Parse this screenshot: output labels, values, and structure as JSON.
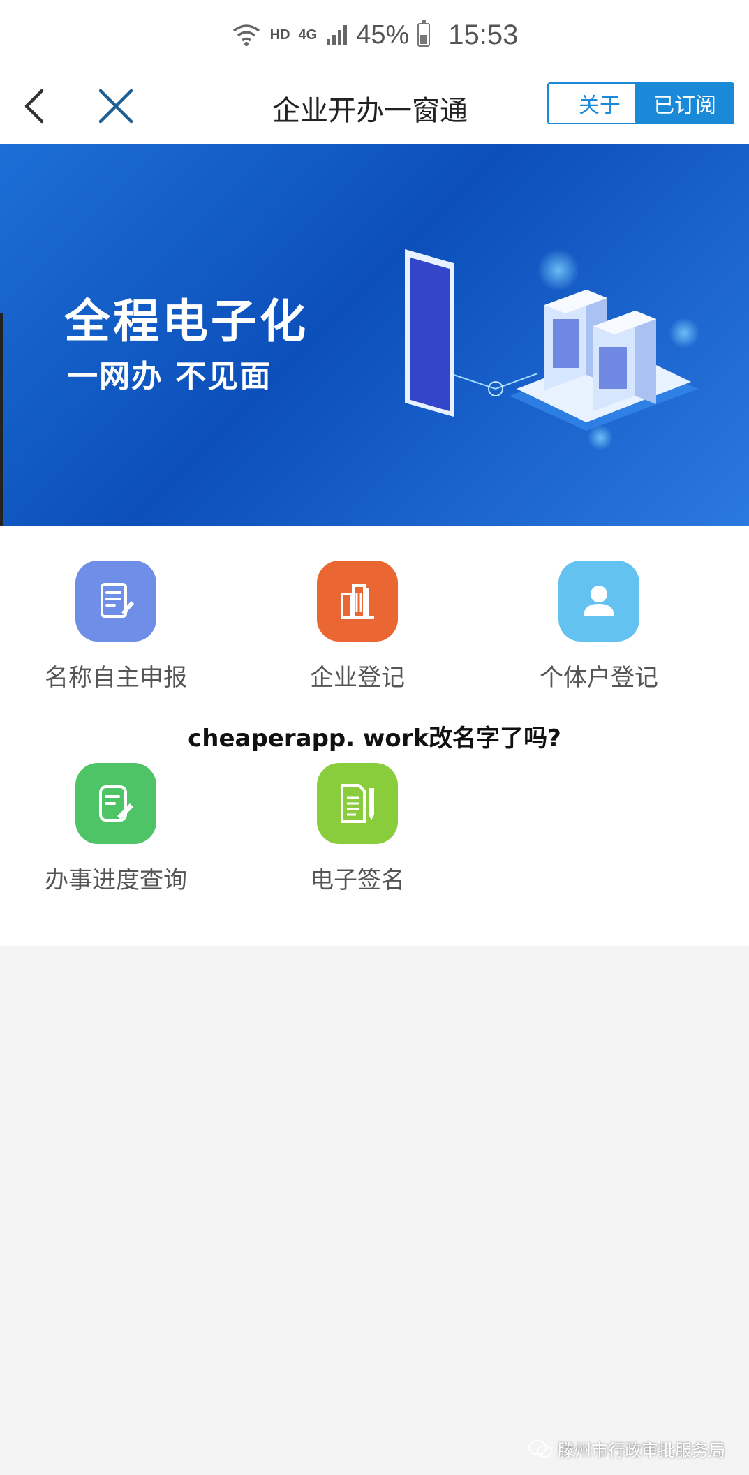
{
  "status_bar": {
    "network_label": "HD",
    "signal_label": "4G",
    "battery_percent": "45%",
    "time": "15:53",
    "icons": [
      "wifi-icon",
      "signal-icon",
      "battery-icon"
    ]
  },
  "title_bar": {
    "title": "企业开办一窗通",
    "about_label": "关于",
    "subscribed_label": "已订阅",
    "icons": [
      "back-icon",
      "close-icon"
    ]
  },
  "banner": {
    "heading": "全程电子化",
    "subheading": "一网办 不见面"
  },
  "services": [
    {
      "label": "名称自主申报",
      "icon": "edit-form-icon",
      "color": "#6f8ee8"
    },
    {
      "label": "企业登记",
      "icon": "building-icon",
      "color": "#ea6632"
    },
    {
      "label": "个体户登记",
      "icon": "person-icon",
      "color": "#64c2f0"
    },
    {
      "label": "办事进度查询",
      "icon": "progress-check-icon",
      "color": "#4fc466"
    },
    {
      "label": "电子签名",
      "icon": "document-sign-icon",
      "color": "#8acd3c"
    }
  ],
  "overlay_caption": "cheaperapp. work改名字了吗?",
  "watermark": "滕州市行政审批服务局",
  "colors": {
    "accent": "#1a8ad8",
    "banner": "#1265cc",
    "background": "#f4f4f4"
  }
}
